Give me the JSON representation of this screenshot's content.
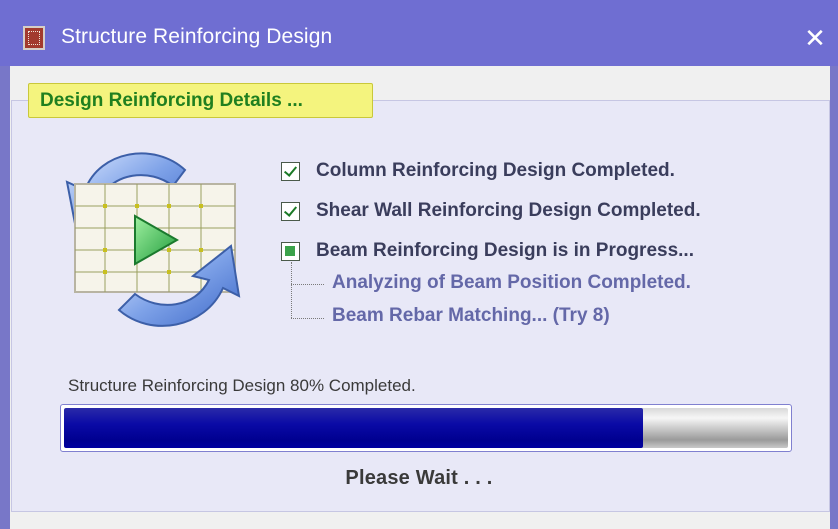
{
  "window": {
    "title": "Structure Reinforcing Design",
    "close_glyph": "✕",
    "app_icon": "structure-app-icon"
  },
  "tab": {
    "label": "Design Reinforcing Details ..."
  },
  "illustration": {
    "icon": "reinforcing-design-icon"
  },
  "steps": [
    {
      "label": "Column Reinforcing Design Completed.",
      "state": "checked"
    },
    {
      "label": "Shear Wall Reinforcing Design Completed.",
      "state": "checked"
    },
    {
      "label": "Beam Reinforcing Design is in Progress...",
      "state": "indeterminate"
    }
  ],
  "substeps": [
    {
      "label": "Analyzing of Beam Position Completed."
    },
    {
      "label": "Beam Rebar Matching... (Try 8)"
    }
  ],
  "progress": {
    "status_text": "Structure Reinforcing Design  80% Completed.",
    "fraction": 0.8
  },
  "wait_text": "Please Wait . . .",
  "colors": {
    "titlebar": "#6f6ed2",
    "tab_bg": "#f4f47e",
    "tab_text": "#1f7f1f",
    "progress_fill": "#000090",
    "substep_text": "#6468a8"
  }
}
